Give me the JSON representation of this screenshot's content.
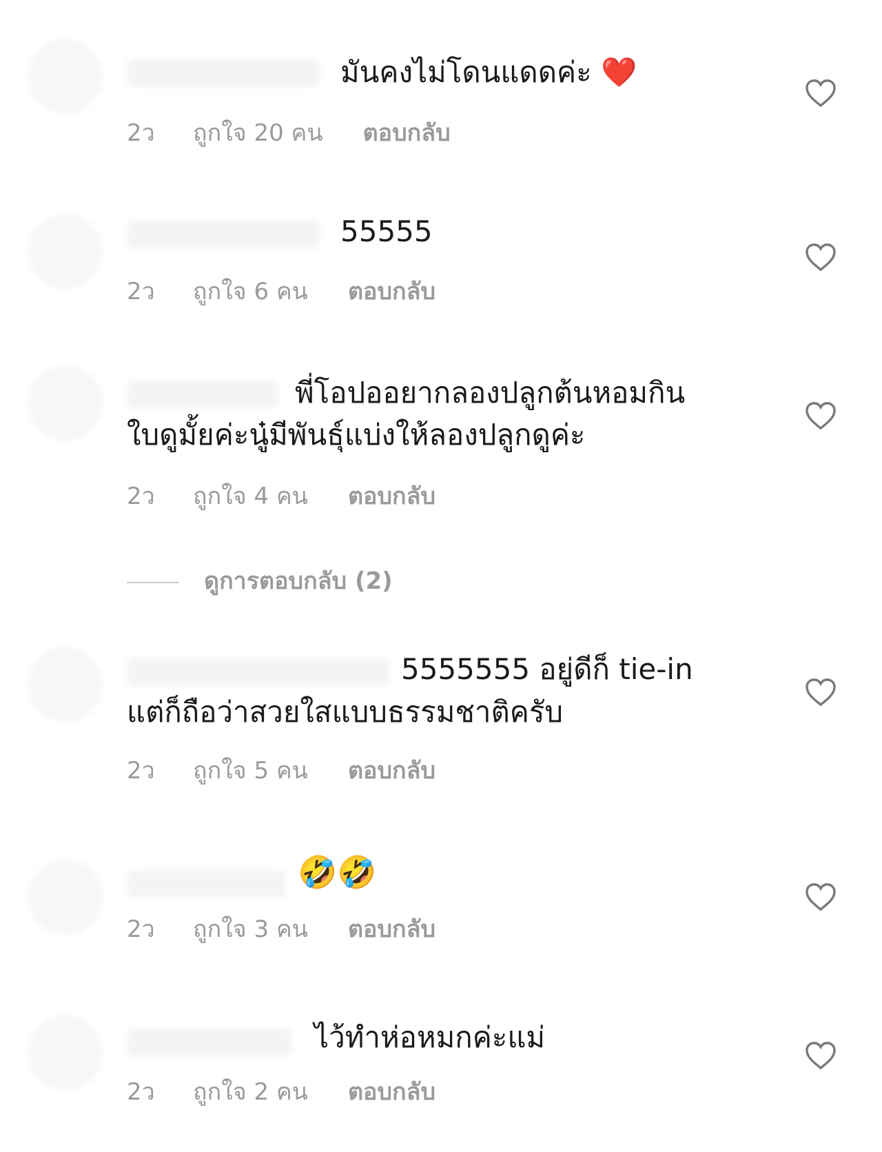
{
  "comments": [
    {
      "text_lines": [
        "มันคงไม่โดนแดดค่ะ ❤️"
      ],
      "age": "2ว",
      "likes": "ถูกใจ 20 คน",
      "reply": "ตอบกลับ"
    },
    {
      "text_lines": [
        "55555"
      ],
      "age": "2ว",
      "likes": "ถูกใจ 6 คน",
      "reply": "ตอบกลับ"
    },
    {
      "text_lines": [
        "พี่โอปออยากลองปลูกต้นหอมกิน",
        "ใบดูมั้ยค่ะนู๋มีพันธุ์แบ่งให้ลองปลูกดูค่ะ"
      ],
      "age": "2ว",
      "likes": "ถูกใจ 4 คน",
      "reply": "ตอบกลับ"
    },
    {
      "text_lines": [
        "5555555 อยู่ดีก็ tie-in",
        "แต่ก็ถือว่าสวยใสแบบธรรมชาติครับ"
      ],
      "age": "2ว",
      "likes": "ถูกใจ 5 คน",
      "reply": "ตอบกลับ"
    },
    {
      "text_lines": [
        "🤣🤣"
      ],
      "age": "2ว",
      "likes": "ถูกใจ 3 คน",
      "reply": "ตอบกลับ"
    },
    {
      "text_lines": [
        "ไว้ทำห่อหมกค่ะแม่"
      ],
      "age": "2ว",
      "likes": "ถูกใจ 2 คน",
      "reply": "ตอบกลับ"
    }
  ],
  "view_replies": "ดูการตอบกลับ (2)",
  "icons": {
    "like": "heart-outline-icon"
  },
  "colors": {
    "meta_text": "#9a9a9a",
    "heart_stroke": "#7a7a7a"
  }
}
